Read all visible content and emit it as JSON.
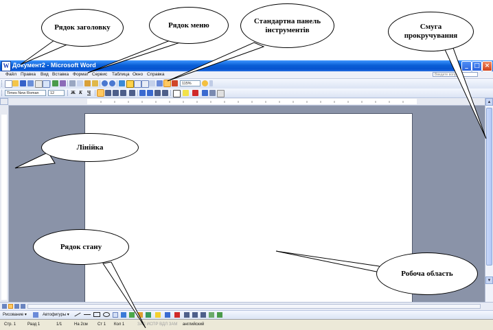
{
  "window": {
    "title": "Документ2 - Microsoft Word",
    "icon_letter": "W",
    "buttons": {
      "minimize": "_",
      "maximize": "□",
      "close": "×"
    }
  },
  "menu": {
    "items": [
      "Файл",
      "Правка",
      "Вид",
      "Вставка",
      "Формат",
      "Сервис",
      "Таблица",
      "Окно",
      "Справка"
    ],
    "help_placeholder": "Введите вопрос"
  },
  "toolbar_standard": {
    "zoom": "115%"
  },
  "toolbar_format": {
    "style": "",
    "font": "Times New Roman",
    "size": "12",
    "bold": "Ж",
    "italic": "К",
    "underline": "Ч"
  },
  "drawing_toolbar": {
    "draw_label": "Рисование ▾",
    "autoshapes_label": "Автофигуры ▾"
  },
  "status_bar": {
    "page": "Стр. 1",
    "section": "Разд 1",
    "page_of": "1/1",
    "at": "На 2см",
    "line": "Ст 1",
    "col": "Кол 1",
    "modes": "ЗАП  ИСПР  ВДЛ  ЗАМ",
    "language": "английский"
  },
  "callouts": {
    "title_bar": "Рядок заголовку",
    "menu_bar": "Рядок меню",
    "standard_toolbar": "Стандартна панель інструментів",
    "scrollbar": "Смуга прокручування",
    "ruler": "Лінійка",
    "status_bar": "Рядок стану",
    "work_area": "Робоча область"
  },
  "colors": {
    "title_bar": "#0a5fd6",
    "document_background": "#8a93a8",
    "status_bar": "#ece9d8"
  }
}
